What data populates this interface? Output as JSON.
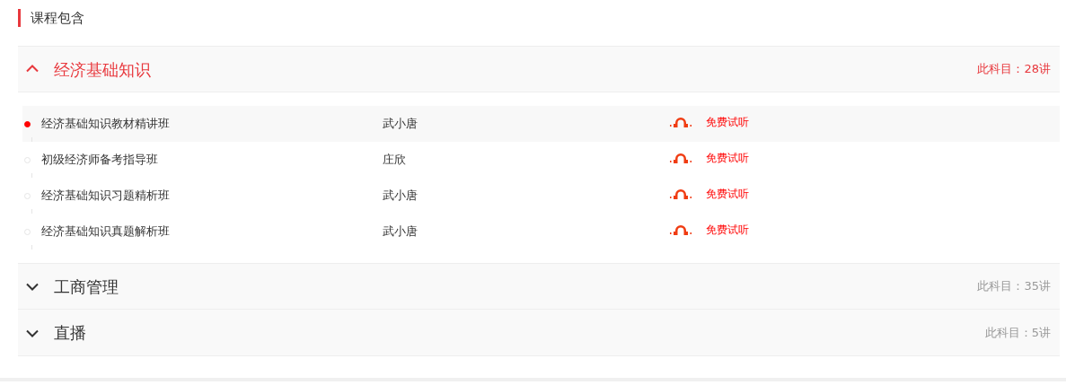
{
  "heading": "课程包含",
  "sections": [
    {
      "title": "经济基础知识",
      "count": "此科目：28讲",
      "expanded": true,
      "lessons": [
        {
          "name": "经济基础知识教材精讲班",
          "teacher": "武小唐",
          "trial": "免费试听",
          "selected": true
        },
        {
          "name": "初级经济师备考指导班",
          "teacher": "庄欣",
          "trial": "免费试听",
          "selected": false
        },
        {
          "name": "经济基础知识习题精析班",
          "teacher": "武小唐",
          "trial": "免费试听",
          "selected": false
        },
        {
          "name": "经济基础知识真题解析班",
          "teacher": "武小唐",
          "trial": "免费试听",
          "selected": false
        }
      ]
    },
    {
      "title": "工商管理",
      "count": "此科目：35讲",
      "expanded": false
    },
    {
      "title": "直播",
      "count": "此科目：5讲",
      "expanded": false
    }
  ]
}
